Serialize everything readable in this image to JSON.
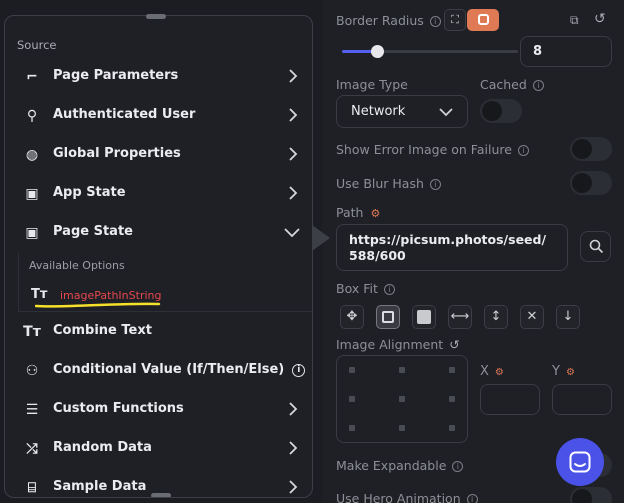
{
  "props": {
    "border_radius_label": "Border Radius",
    "border_radius_value": "8",
    "slider_fraction": 0.2,
    "image_type_label": "Image Type",
    "image_type_value": "Network",
    "cached_label": "Cached",
    "show_error_label": "Show Error Image on Failure",
    "blur_hash_label": "Use Blur Hash",
    "path_label": "Path",
    "path_value_line1": "https://picsum.photos/seed/",
    "path_value_line2": "588/600",
    "box_fit_label": "Box Fit",
    "alignment_label": "Image Alignment",
    "x_label": "X",
    "y_label": "Y",
    "expandable_label": "Make Expandable",
    "hero_label": "Use Hero Animation",
    "accent_color": "#e07a55",
    "chat_color": "#4b52e8"
  },
  "source": {
    "title": "Source",
    "items_top": [
      {
        "label": "Page Parameters",
        "icon": "page-parameters-icon"
      },
      {
        "label": "Authenticated User",
        "icon": "user-icon"
      },
      {
        "label": "Global Properties",
        "icon": "globe-icon"
      },
      {
        "label": "App State",
        "icon": "app-state-icon"
      },
      {
        "label": "Page State",
        "icon": "page-state-icon"
      }
    ],
    "available_options_title": "Available Options",
    "option_label": "imagePathInString",
    "items_bottom": [
      {
        "label": "Combine Text",
        "icon": "text-icon"
      },
      {
        "label": "Conditional Value (If/Then/Else)",
        "icon": "conditional-icon"
      },
      {
        "label": "Custom Functions",
        "icon": "custom-functions-icon"
      },
      {
        "label": "Random Data",
        "icon": "shuffle-icon"
      },
      {
        "label": "Sample Data",
        "icon": "sample-data-icon"
      }
    ]
  }
}
